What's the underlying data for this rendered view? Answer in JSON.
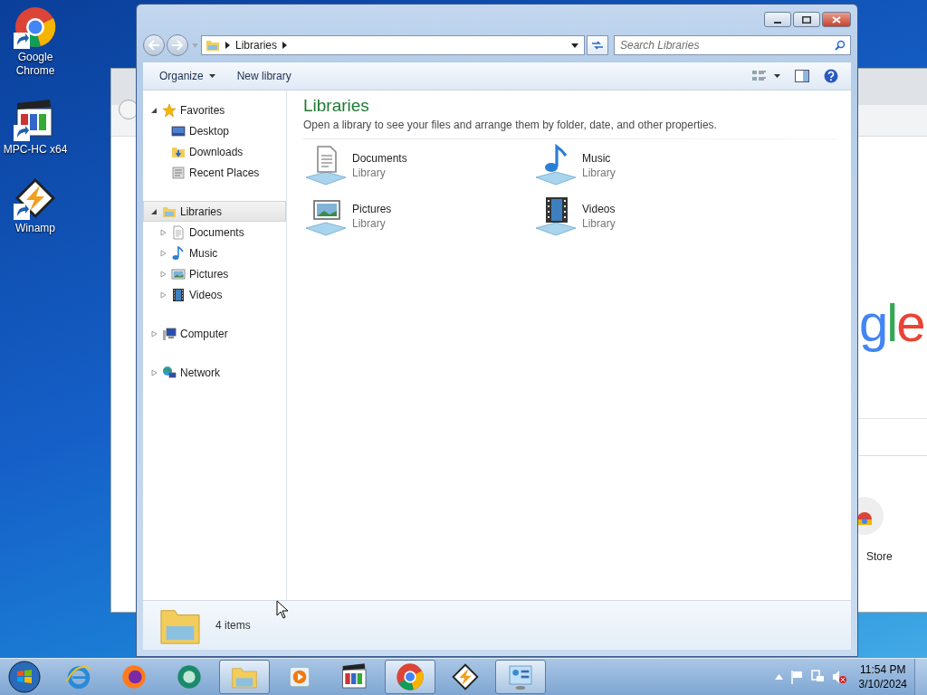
{
  "desktop_icons": [
    {
      "label": "Google\nChrome",
      "kind": "chrome"
    },
    {
      "label": "MPC-HC x64",
      "kind": "mpc"
    },
    {
      "label": "Winamp",
      "kind": "winamp"
    }
  ],
  "browser_window": {
    "logo_text": "gle",
    "shortcut_label": "Store"
  },
  "explorer": {
    "address": {
      "crumbs": [
        "Libraries"
      ]
    },
    "search": {
      "placeholder": "Search Libraries"
    },
    "toolbar": [
      {
        "label": "Organize",
        "dropdown": true
      },
      {
        "label": "New library",
        "dropdown": false
      }
    ],
    "nav": [
      {
        "label": "Favorites",
        "kind": "star",
        "expanded": true,
        "selected": false,
        "children": [
          {
            "label": "Desktop",
            "kind": "desktop",
            "selected": false
          },
          {
            "label": "Downloads",
            "kind": "downloads",
            "selected": false
          },
          {
            "label": "Recent Places",
            "kind": "recent",
            "selected": false
          }
        ]
      },
      {
        "label": "Libraries",
        "kind": "library",
        "expanded": true,
        "selected": true,
        "children": [
          {
            "label": "Documents",
            "kind": "documents",
            "expanded": false,
            "selected": false
          },
          {
            "label": "Music",
            "kind": "music",
            "expanded": false,
            "selected": false
          },
          {
            "label": "Pictures",
            "kind": "pictures",
            "expanded": false,
            "selected": false
          },
          {
            "label": "Videos",
            "kind": "videos",
            "expanded": false,
            "selected": false
          }
        ]
      },
      {
        "label": "Computer",
        "kind": "computer",
        "expanded": false,
        "selected": false
      },
      {
        "label": "Network",
        "kind": "network",
        "expanded": false,
        "selected": false
      }
    ],
    "content": {
      "title": "Libraries",
      "subtitle": "Open a library to see your files and arrange them by folder, date, and other properties.",
      "items": [
        {
          "name": "Documents",
          "type": "Library",
          "kind": "documents"
        },
        {
          "name": "Music",
          "type": "Library",
          "kind": "music"
        },
        {
          "name": "Pictures",
          "type": "Library",
          "kind": "pictures"
        },
        {
          "name": "Videos",
          "type": "Library",
          "kind": "videos"
        }
      ]
    },
    "details": {
      "count": "4 items"
    }
  },
  "taskbar": {
    "buttons": [
      {
        "kind": "ie",
        "running": false
      },
      {
        "kind": "firefox",
        "running": false
      },
      {
        "kind": "circle",
        "running": false
      },
      {
        "kind": "explorer",
        "running": true
      },
      {
        "kind": "player",
        "running": false
      },
      {
        "kind": "mpc",
        "running": false
      },
      {
        "kind": "chrome",
        "running": true
      },
      {
        "kind": "winamp",
        "running": false
      },
      {
        "kind": "control",
        "running": true
      }
    ],
    "clock": {
      "time": "11:54 PM",
      "date": "3/10/2024"
    }
  }
}
